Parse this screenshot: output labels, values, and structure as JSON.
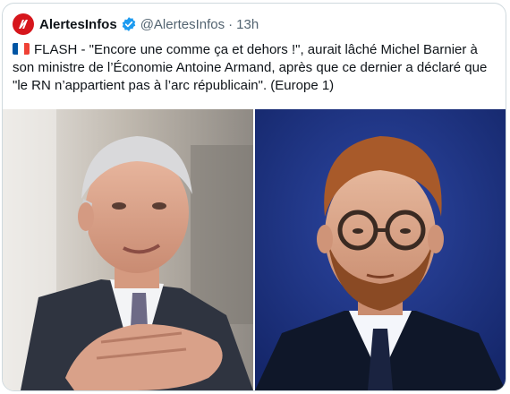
{
  "author": {
    "name": "AlertesInfos",
    "handle": "@AlertesInfos",
    "separator": "·",
    "time": "13h",
    "verified": true,
    "avatar_color": "#d6161c"
  },
  "tweet": {
    "flag_icon": "france-flag-icon",
    "text": "FLASH - \"Encore une comme ça et dehors !\", aurait lâché Michel Barnier à son ministre de l’Économie Antoine Armand, après que ce dernier a déclaré que \"le RN n’appartient pas à l’arc républicain\". (Europe 1)"
  },
  "media": [
    {
      "name": "photo-michel-barnier",
      "background": "#c9c4bd"
    },
    {
      "name": "photo-antoine-armand",
      "background": "#233a8c"
    }
  ],
  "colors": {
    "verified": "#1d9bf0",
    "secondary_text": "#536471",
    "primary_text": "#0f1419",
    "border": "#cfd9de"
  }
}
